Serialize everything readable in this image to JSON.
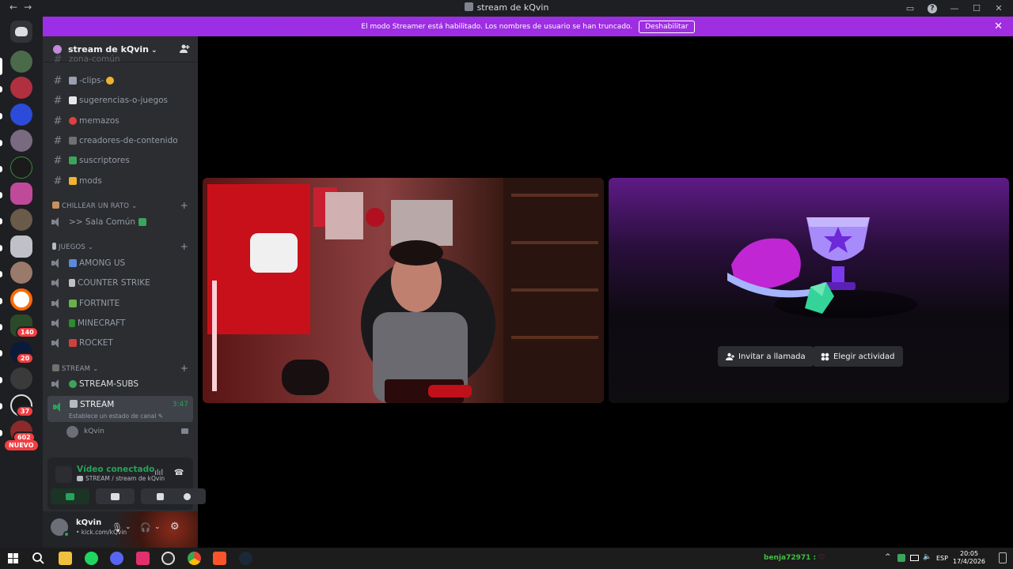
{
  "window": {
    "title": "stream de kQvin",
    "nav_back": "←",
    "nav_forward": "→",
    "min_glyph": "—",
    "max_glyph": "☐",
    "close_glyph": "✕",
    "help_glyph": "?",
    "inbox_glyph": "▭"
  },
  "banner": {
    "text": "El modo Streamer está habilitado. Los nombres de usuario se han truncado.",
    "button": "Deshabilitar",
    "close": "✕",
    "color": "#9b2ee6"
  },
  "servers": {
    "badges": [
      "140",
      "20",
      "37",
      "602"
    ],
    "new_label": "NUEVO"
  },
  "guild": {
    "name": "stream de kQvin",
    "chevron": "⌄"
  },
  "channels": {
    "partial": "zona-común",
    "text": [
      {
        "name": "-clips-"
      },
      {
        "name": "sugerencias-o-juegos"
      },
      {
        "name": "memazos"
      },
      {
        "name": "creadores-de-contenido"
      },
      {
        "name": "suscriptores"
      },
      {
        "name": "mods"
      }
    ],
    "category_chill": "CHILLEAR UN RATO",
    "chill": [
      {
        "name": ">> Sala Común"
      }
    ],
    "category_games": "JUEGOS",
    "games": [
      {
        "name": "AMONG US"
      },
      {
        "name": "COUNTER STRIKE"
      },
      {
        "name": "FORTNITE"
      },
      {
        "name": "MINECRAFT"
      },
      {
        "name": "ROCKET"
      }
    ],
    "category_stream": "STREAM",
    "stream_subs": "STREAM-SUBS",
    "active": {
      "name": "STREAM",
      "timer": "3:47",
      "status": "Establece un estado de canal"
    },
    "member": "kQvin",
    "hash": "#",
    "plus": "+",
    "cat_chevron": "⌄"
  },
  "voice_panel": {
    "title": "Vídeo conectado",
    "subtitle": "STREAM / stream de kQvin",
    "wave": "ılıl",
    "hangup": "☎"
  },
  "user": {
    "name": "kQvin",
    "status": "• kick.com/kQvin",
    "mic": "🎙",
    "headset": "🎧",
    "settings": "⚙",
    "chev": "⌄"
  },
  "activity": {
    "invite": "Invitar a llamada",
    "choose": "Elegir actividad"
  },
  "taskbar": {
    "user_text": "benja72971 :",
    "lang": "ESP",
    "time": "20:05",
    "date": "17/4/2026",
    "caret": "^"
  }
}
